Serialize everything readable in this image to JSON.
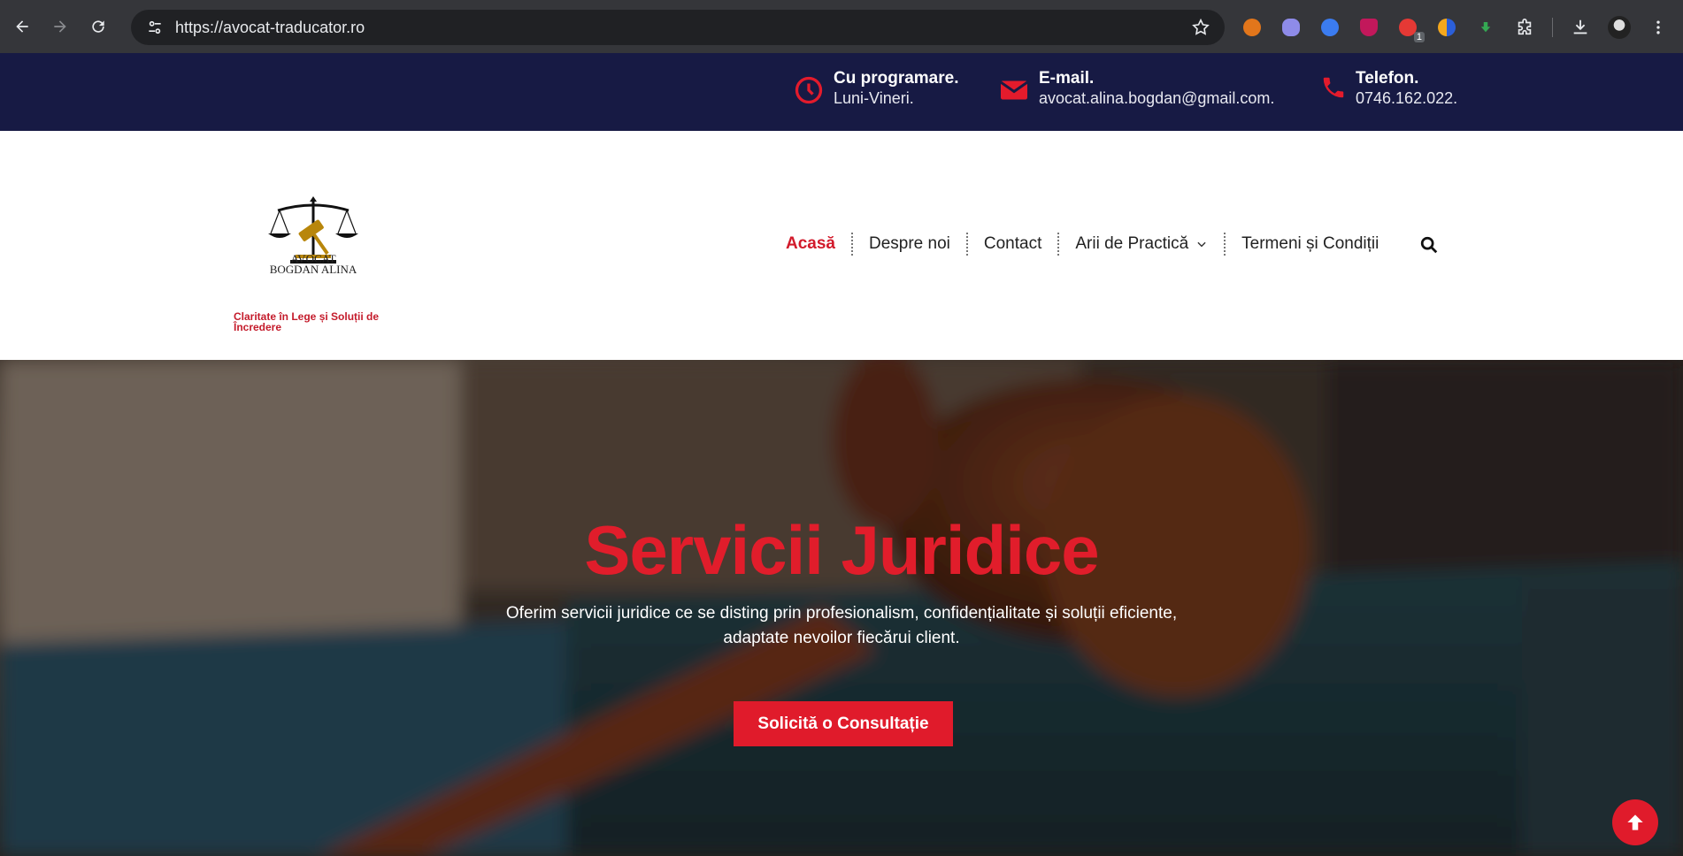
{
  "browser": {
    "url": "https://avocat-traducator.ro",
    "extension_badge": "1"
  },
  "info_bar": {
    "schedule": {
      "title": "Cu programare.",
      "sub": "Luni-Vineri."
    },
    "email": {
      "title": "E-mail.",
      "sub": "avocat.alina.bogdan@gmail.com."
    },
    "phone": {
      "title": "Telefon.",
      "sub": "0746.162.022."
    }
  },
  "header": {
    "logo_line1": "AVOCAT",
    "logo_line2": "BOGDAN ALINA",
    "tagline": "Claritate în Lege și Soluții de Încredere",
    "menu": [
      {
        "label": "Acasă"
      },
      {
        "label": "Despre noi"
      },
      {
        "label": "Contact"
      },
      {
        "label": "Arii de Practică"
      },
      {
        "label": "Termeni și Condiții"
      }
    ]
  },
  "hero": {
    "title": "Servicii Juridice",
    "text": "Oferim servicii juridice ce se disting prin profesionalism, confidențialitate și soluții eficiente, adaptate nevoilor fiecărui client.",
    "button": "Solicită o Consultație"
  },
  "colors": {
    "brand_red": "#e01b2b",
    "navy": "#171a44"
  }
}
